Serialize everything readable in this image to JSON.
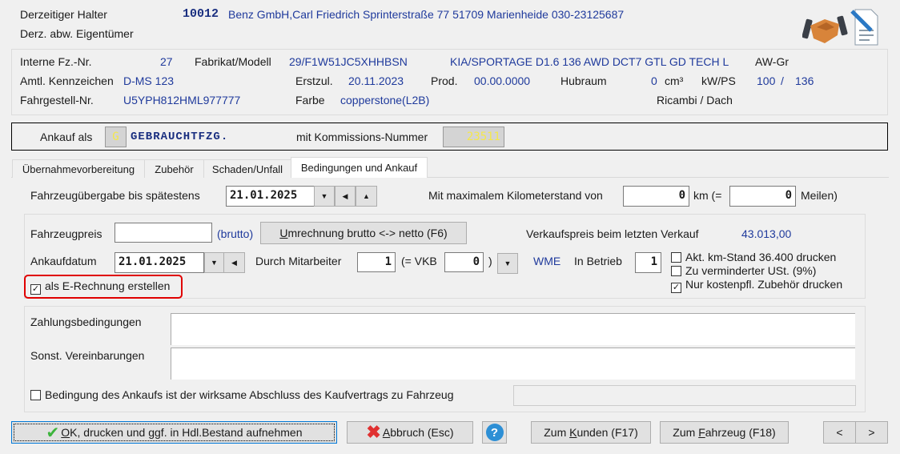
{
  "header": {
    "holder_label": "Derzeitiger Halter",
    "holder_id": "10012",
    "holder_address": "Benz GmbH,Carl Friedrich Sprinterstraße 77 51709 Marienheide 030-23125687",
    "owner_label": "Derz. abw. Eigentümer",
    "icons": [
      "handshake-icon",
      "contract-document-icon"
    ]
  },
  "vehicle": {
    "internal_no_label": "Interne Fz.-Nr.",
    "internal_no": "27",
    "model_label": "Fabrikat/Modell",
    "model_code": "29/F1W51JC5XHHBSN",
    "model_name": "KIA/SPORTAGE D1.6 136 AWD DCT7 GTL GD TECH L",
    "awgr_label": "AW-Gr",
    "plate_label": "Amtl. Kennzeichen",
    "plate": "D-MS 123",
    "first_reg_label": "Erstzul.",
    "first_reg": "20.11.2023",
    "prod_label": "Prod.",
    "prod": "00.00.0000",
    "displacement_label": "Hubraum",
    "displacement": "0",
    "displacement_unit": "cm³",
    "power_label": "kW/PS",
    "kw": "100",
    "slash": "/",
    "ps": "136",
    "vin_label": "Fahrgestell-Nr.",
    "vin": "U5YPH812HML977777",
    "color_label": "Farbe",
    "color": "copperstone(L2B)",
    "ricambi": "Ricambi / Dach"
  },
  "purchase": {
    "as_label": "Ankauf als",
    "type_code": "G",
    "type_name": "GEBRAUCHTFZG.",
    "commission_label": "mit Kommissions-Nummer",
    "commission_no": "23511"
  },
  "tabs": [
    {
      "label": "Übernahmevorbereitung"
    },
    {
      "label": "Zubehör"
    },
    {
      "label": "Schaden/Unfall"
    },
    {
      "label": "Bedingungen und Ankauf",
      "active": true
    }
  ],
  "form": {
    "handover_label": "Fahrzeugübergabe bis spätestens",
    "handover_date": "21.01.2025",
    "max_km_label": "Mit maximalem Kilometerstand von",
    "max_km": "0",
    "km_eq": "km (=",
    "miles": "0",
    "miles_label": "Meilen)",
    "price_label": "Fahrzeugpreis",
    "price": "",
    "brutto": "(brutto)",
    "convert_btn_u": "U",
    "convert_btn": "mrechnung brutto <-> netto (F6)",
    "last_sale_label": "Verkaufspreis beim letzten Verkauf",
    "last_sale": "43.013,00",
    "purchase_date_label": "Ankaufdatum",
    "purchase_date": "21.01.2025",
    "employee_label": "Durch Mitarbeiter",
    "employee": "1",
    "vkb_label": "(= VKB",
    "vkb": "0",
    "close_paren": ")",
    "wme": "WME",
    "in_operation_label": "In Betrieb",
    "in_operation": "1",
    "checkboxes": [
      {
        "label": "Akt. km-Stand 36.400 drucken",
        "checked": false
      },
      {
        "label": "Zu verminderter USt. (9%)",
        "checked": false
      },
      {
        "label": "Nur kostenpfl. Zubehör drucken",
        "checked": true
      }
    ],
    "e_invoice": {
      "label": "als E-Rechnung erstellen",
      "checked": true
    },
    "payment_label": "Zahlungsbedingungen",
    "payment": "",
    "other_label": "Sonst. Vereinbarungen",
    "other": "",
    "condition": {
      "label": "Bedingung des Ankaufs ist der wirksame Abschluss des Kaufvertrags zu Fahrzeug",
      "checked": false,
      "value": ""
    }
  },
  "buttons": {
    "ok_u": "O",
    "ok": "K, drucken und ggf. in Hdl.Bestand aufnehmen",
    "cancel_u": "A",
    "cancel": "bbruch (Esc)",
    "help": "?",
    "customer_pre": "Zum ",
    "customer_u": "K",
    "customer": "unden (F17)",
    "vehicle_pre": "Zum ",
    "vehicle_u": "F",
    "vehicle": "ahrzeug (F18)",
    "prev": "<",
    "next": ">"
  },
  "colors": {
    "value_text": "#1f3a9c",
    "highlight": "#e00000",
    "code_yellow": "#f5e84a"
  }
}
